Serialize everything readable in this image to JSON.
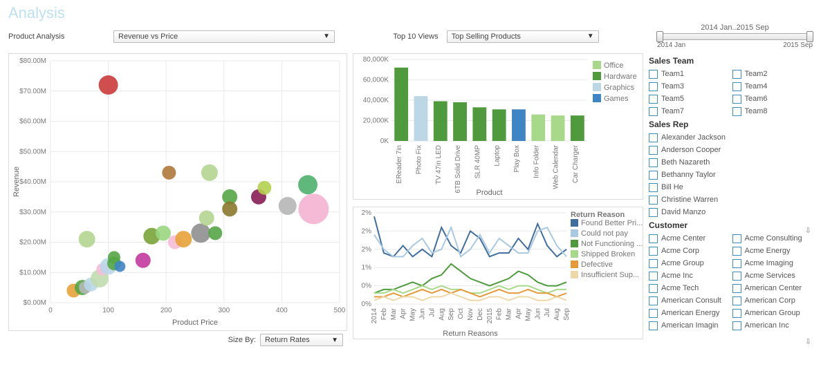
{
  "title": "Analysis",
  "product_analysis": {
    "label": "Product Analysis",
    "dropdown": "Revenue vs Price"
  },
  "top10": {
    "label": "Top 10 Views",
    "dropdown": "Top Selling Products"
  },
  "size_by": {
    "label": "Size By:",
    "dropdown": "Return Rates"
  },
  "date_slider": {
    "title": "2014 Jan..2015 Sep",
    "start": "2014 Jan",
    "end": "2015 Sep"
  },
  "filters": {
    "sales_team": {
      "title": "Sales Team",
      "items": [
        "Team1",
        "Team2",
        "Team3",
        "Team4",
        "Team5",
        "Team6",
        "Team7",
        "Team8"
      ]
    },
    "sales_rep": {
      "title": "Sales Rep",
      "items": [
        "Alexander Jackson",
        "Anderson Cooper",
        "Beth Nazareth",
        "Bethanny Taylor",
        "Bill He",
        "Christine Warren",
        "David Manzo"
      ]
    },
    "customer": {
      "title": "Customer",
      "items": [
        "Acme Center",
        "Acme Consulting",
        "Acme Corp",
        "Acme Energy",
        "Acme Group",
        "Acme Imaging",
        "Acme Inc",
        "Acme Services",
        "Acme Tech",
        "American Center",
        "American Consult",
        "American Corp",
        "American Energy",
        "American Group",
        "American Imagin",
        "American Inc"
      ]
    }
  },
  "chart_data": [
    {
      "id": "revenue_vs_price",
      "type": "bubble",
      "title": "",
      "xlabel": "Product Price",
      "ylabel": "Revenue",
      "xlim": [
        0,
        500
      ],
      "ylim": [
        0,
        80
      ],
      "y_unit": "M",
      "x_ticks": [
        0,
        100,
        200,
        300,
        400,
        500
      ],
      "y_ticks": [
        0,
        10,
        20,
        30,
        40,
        50,
        60,
        70,
        80
      ],
      "size_legend": "Return Rates",
      "points": [
        {
          "x": 40,
          "y": 4,
          "r": 10,
          "color": "#e8a23a"
        },
        {
          "x": 55,
          "y": 5,
          "r": 11,
          "color": "#55a546"
        },
        {
          "x": 60,
          "y": 5,
          "r": 9,
          "color": "#b6b6b6"
        },
        {
          "x": 70,
          "y": 6,
          "r": 10,
          "color": "#b9d7e8"
        },
        {
          "x": 63,
          "y": 21,
          "r": 12,
          "color": "#b2d58f"
        },
        {
          "x": 85,
          "y": 8,
          "r": 13,
          "color": "#c1dcae"
        },
        {
          "x": 90,
          "y": 11,
          "r": 9,
          "color": "#f6bdd7"
        },
        {
          "x": 100,
          "y": 12,
          "r": 12,
          "color": "#b9d7e8"
        },
        {
          "x": 110,
          "y": 13,
          "r": 10,
          "color": "#55a546"
        },
        {
          "x": 110,
          "y": 15,
          "r": 9,
          "color": "#55a546"
        },
        {
          "x": 120,
          "y": 12,
          "r": 8,
          "color": "#3f84c4"
        },
        {
          "x": 100,
          "y": 72,
          "r": 14,
          "color": "#cc3b3b"
        },
        {
          "x": 160,
          "y": 14,
          "r": 11,
          "color": "#c438a0"
        },
        {
          "x": 175,
          "y": 22,
          "r": 12,
          "color": "#7aa338"
        },
        {
          "x": 195,
          "y": 23,
          "r": 11,
          "color": "#99d67f"
        },
        {
          "x": 215,
          "y": 20,
          "r": 10,
          "color": "#f6bdd7"
        },
        {
          "x": 230,
          "y": 21,
          "r": 12,
          "color": "#e8a23a"
        },
        {
          "x": 260,
          "y": 23,
          "r": 14,
          "color": "#8f8f8f"
        },
        {
          "x": 270,
          "y": 28,
          "r": 11,
          "color": "#b2d58f"
        },
        {
          "x": 285,
          "y": 23,
          "r": 10,
          "color": "#55a546"
        },
        {
          "x": 205,
          "y": 43,
          "r": 10,
          "color": "#b0783c"
        },
        {
          "x": 275,
          "y": 43,
          "r": 12,
          "color": "#b2d58f"
        },
        {
          "x": 310,
          "y": 35,
          "r": 11,
          "color": "#55a546"
        },
        {
          "x": 310,
          "y": 31,
          "r": 11,
          "color": "#8a7a2e"
        },
        {
          "x": 360,
          "y": 35,
          "r": 11,
          "color": "#881e55"
        },
        {
          "x": 370,
          "y": 38,
          "r": 10,
          "color": "#b5cf4f"
        },
        {
          "x": 410,
          "y": 32,
          "r": 13,
          "color": "#b6b6b6"
        },
        {
          "x": 445,
          "y": 39,
          "r": 14,
          "color": "#4fb06f"
        },
        {
          "x": 455,
          "y": 31,
          "r": 22,
          "color": "#f4b4d2"
        }
      ]
    },
    {
      "id": "top_selling_products",
      "type": "bar",
      "title": "",
      "xlabel": "Product",
      "ylabel": "",
      "y_ticks": [
        0,
        20000,
        40000,
        60000,
        80000
      ],
      "y_tick_labels": [
        "0K",
        "20,000K",
        "40,000K",
        "60,000K",
        "80,000K"
      ],
      "legend": [
        {
          "name": "Office",
          "color": "#a8d88a"
        },
        {
          "name": "Hardware",
          "color": "#4f9a3d"
        },
        {
          "name": "Graphics",
          "color": "#bcd8e6"
        },
        {
          "name": "Games",
          "color": "#3f84c4"
        }
      ],
      "categories": [
        "EReader 7in",
        "Photo Fix",
        "TV 47in LED",
        "6TB Solid Drive",
        "SLR 40MP",
        "Laptop",
        "Play Box",
        "Info Folder",
        "Web Calendar",
        "Car Charger"
      ],
      "bars": [
        {
          "cat": "EReader 7in",
          "value": 72000,
          "series": "Hardware"
        },
        {
          "cat": "Photo Fix",
          "value": 44000,
          "series": "Graphics"
        },
        {
          "cat": "TV 47in LED",
          "value": 39000,
          "series": "Hardware"
        },
        {
          "cat": "6TB Solid Drive",
          "value": 38000,
          "series": "Hardware"
        },
        {
          "cat": "SLR 40MP",
          "value": 33000,
          "series": "Hardware"
        },
        {
          "cat": "Laptop",
          "value": 31000,
          "series": "Hardware"
        },
        {
          "cat": "Play Box",
          "value": 31000,
          "series": "Games"
        },
        {
          "cat": "Info Folder",
          "value": 26000,
          "series": "Office"
        },
        {
          "cat": "Web Calendar",
          "value": 25000,
          "series": "Office"
        },
        {
          "cat": "Car Charger",
          "value": 25000,
          "series": "Hardware"
        }
      ]
    },
    {
      "id": "return_reasons",
      "type": "line",
      "title": "Return Reasons",
      "legend_title": "Return Reason",
      "xlabel": "",
      "ylabel": "",
      "ylim": [
        0,
        2.5
      ],
      "y_unit": "%",
      "y_ticks": [
        0,
        0.5,
        1,
        1.5,
        2,
        2
      ],
      "y_tick_labels": [
        "0%",
        "0%",
        "1%",
        "2%",
        "2%",
        "2%"
      ],
      "x": [
        "2014",
        "Feb",
        "Mar",
        "Apr",
        "May",
        "Jun",
        "Jul",
        "Aug",
        "Sep",
        "Oct",
        "Nov",
        "Dec",
        "2015",
        "Feb",
        "Mar",
        "Apr",
        "May",
        "Jun",
        "Jul",
        "Aug",
        "Sep"
      ],
      "series": [
        {
          "name": "Found Better Pri...",
          "color": "#3f6e9e",
          "values": [
            2.4,
            1.4,
            1.3,
            1.6,
            1.3,
            1.5,
            1.3,
            2.1,
            1.6,
            1.4,
            2.0,
            1.8,
            1.3,
            1.4,
            1.4,
            1.8,
            1.5,
            2.2,
            1.6,
            1.3,
            1.5
          ]
        },
        {
          "name": "Could not pay",
          "color": "#a8c9e1",
          "values": [
            1.9,
            1.5,
            1.3,
            1.3,
            1.6,
            1.8,
            1.4,
            1.5,
            2.1,
            1.3,
            1.5,
            1.9,
            1.4,
            1.8,
            1.6,
            1.4,
            1.4,
            2.0,
            2.1,
            1.6,
            1.3
          ]
        },
        {
          "name": "Not Functioning ...",
          "color": "#4f9a3d",
          "values": [
            0.3,
            0.4,
            0.4,
            0.5,
            0.6,
            0.5,
            0.7,
            0.8,
            1.1,
            0.9,
            0.7,
            0.6,
            0.5,
            0.6,
            0.7,
            0.9,
            0.8,
            0.6,
            0.5,
            0.5,
            0.6
          ]
        },
        {
          "name": "Shipped Broken",
          "color": "#a8d88a",
          "values": [
            0.3,
            0.3,
            0.4,
            0.3,
            0.4,
            0.5,
            0.4,
            0.5,
            0.4,
            0.4,
            0.3,
            0.3,
            0.4,
            0.5,
            0.4,
            0.5,
            0.5,
            0.4,
            0.3,
            0.4,
            0.4
          ]
        },
        {
          "name": "Defective",
          "color": "#e59a3a",
          "values": [
            0.2,
            0.2,
            0.3,
            0.2,
            0.3,
            0.4,
            0.3,
            0.4,
            0.3,
            0.4,
            0.3,
            0.2,
            0.3,
            0.4,
            0.3,
            0.3,
            0.4,
            0.3,
            0.3,
            0.2,
            0.3
          ]
        },
        {
          "name": "Insufficient Sup...",
          "color": "#efd8a8",
          "values": [
            0.1,
            0.2,
            0.1,
            0.2,
            0.2,
            0.1,
            0.2,
            0.2,
            0.3,
            0.2,
            0.1,
            0.1,
            0.2,
            0.2,
            0.1,
            0.2,
            0.2,
            0.1,
            0.1,
            0.2,
            0.1
          ]
        }
      ]
    }
  ]
}
